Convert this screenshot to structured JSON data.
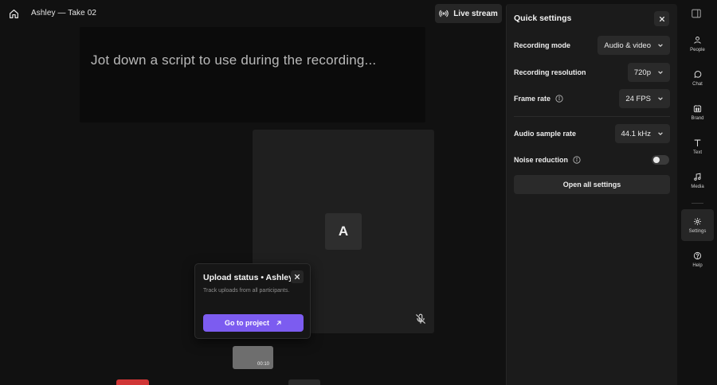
{
  "header": {
    "session_title": "Ashley — Take 02",
    "live_stream_label": "Live stream"
  },
  "script": {
    "placeholder": "Jot down a script to use during the recording..."
  },
  "participant": {
    "initial": "A"
  },
  "upload_status": {
    "title": "Upload status • Ashley",
    "subtitle": "Track uploads from all participants.",
    "go_label": "Go to project"
  },
  "thumbnail": {
    "duration": "00:10"
  },
  "quick_settings": {
    "title": "Quick settings",
    "recording_mode": {
      "label": "Recording mode",
      "value": "Audio & video"
    },
    "recording_resolution": {
      "label": "Recording resolution",
      "value": "720p"
    },
    "frame_rate": {
      "label": "Frame rate",
      "value": "24 FPS"
    },
    "audio_sample_rate": {
      "label": "Audio sample rate",
      "value": "44.1 kHz"
    },
    "noise_reduction": {
      "label": "Noise reduction",
      "enabled": false
    },
    "open_all_label": "Open all settings"
  },
  "rail": {
    "items": [
      {
        "label": "People",
        "icon": "people-icon"
      },
      {
        "label": "Chat",
        "icon": "chat-icon"
      },
      {
        "label": "Brand",
        "icon": "brand-icon"
      },
      {
        "label": "Text",
        "icon": "text-icon"
      },
      {
        "label": "Media",
        "icon": "media-icon"
      },
      {
        "label": "Settings",
        "icon": "gear-icon",
        "active": true
      },
      {
        "label": "Help",
        "icon": "help-icon"
      }
    ]
  },
  "colors": {
    "accent": "#7c5cf0",
    "record": "#d03535",
    "background": "#111111",
    "panel": "#1b1b1b"
  }
}
